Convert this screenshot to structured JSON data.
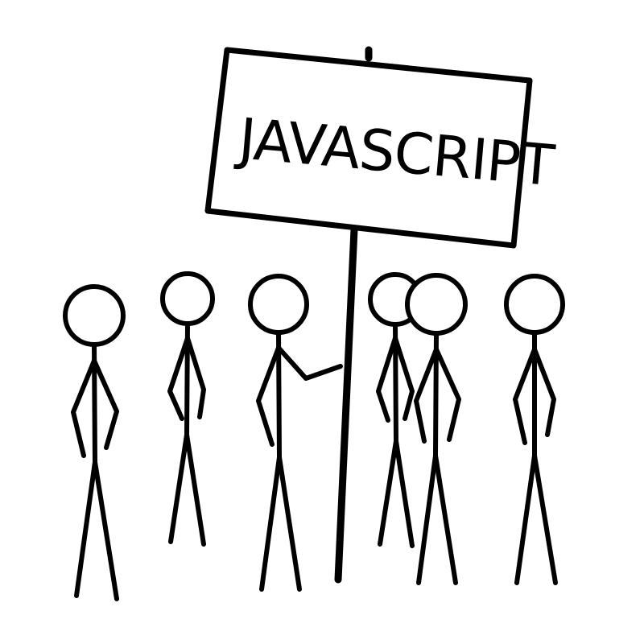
{
  "sign": {
    "text": "JAVASCRIPT"
  },
  "colors": {
    "ink": "#000000",
    "background": "#ffffff"
  }
}
